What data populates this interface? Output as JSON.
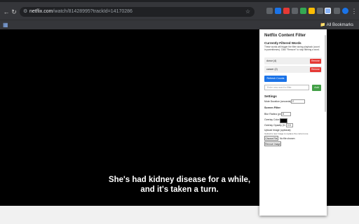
{
  "browser": {
    "url_domain": "netflix.com",
    "url_path": "/watch/81428995?trackId=14170286",
    "all_bookmarks_label": "All Bookmarks",
    "accent_color": "#8ab4f8"
  },
  "video": {
    "subtitle_line1": "She's had kidney disease for a while,",
    "subtitle_line2": "and it's taken a turn."
  },
  "extension_popup": {
    "title": "Netflix Content Filter",
    "filtered_words_heading": "Currently Filtered Words",
    "description": "These words will trigger the filter during playback (count in parentheses). Click \"Remove\" to stop filtering a word.",
    "words": [
      {
        "label": "donor (4)",
        "remove_label": "Remove"
      },
      {
        "label": "cancer (2)",
        "remove_label": "Remove"
      }
    ],
    "refresh_label": "Refresh Counts",
    "new_word_placeholder": "Enter new word to filter",
    "add_label": "Add",
    "settings_heading": "Settings",
    "mute_duration_label": "Mute Duration (seconds):",
    "mute_duration_value": "2",
    "screen_filter_heading": "Screen Filter",
    "blur_radius_label": "Blur Radius (px):",
    "blur_radius_value": "8",
    "overlay_color_label": "Overlay Color:",
    "overlay_color_value": "#000000",
    "overlay_opacity_label": "Overlay Opacity (0-1):",
    "overlay_opacity_value": "0.5",
    "upload_label": "Upload Image (optional):",
    "upload_note": "Upload a new image to replace the current one",
    "choose_file_label": "Choose File",
    "file_status": "No file chosen",
    "remove_image_label": "Remove Image",
    "remove_color": "#e53935",
    "refresh_color": "#1a73e8",
    "add_color": "#43a047"
  }
}
